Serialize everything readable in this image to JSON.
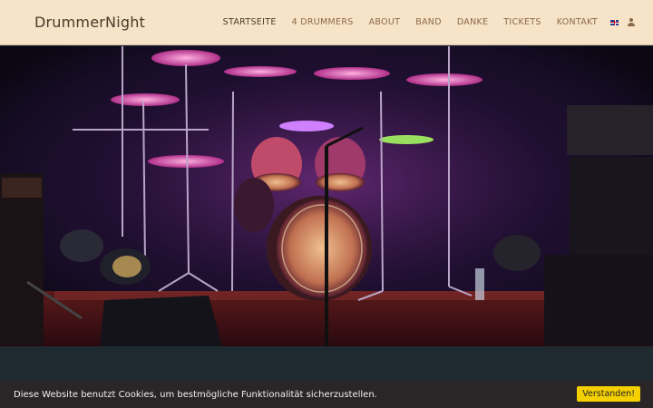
{
  "header": {
    "brand": "DrummerNight",
    "nav": [
      {
        "label": "STARTSEITE",
        "active": true
      },
      {
        "label": "4 DRUMMERS",
        "active": false
      },
      {
        "label": "ABOUT",
        "active": false
      },
      {
        "label": "BAND",
        "active": false
      },
      {
        "label": "DANKE",
        "active": false
      },
      {
        "label": "TICKETS",
        "active": false
      },
      {
        "label": "KONTAKT",
        "active": false
      }
    ],
    "language_icon": "uk-flag-icon",
    "user_icon": "user-icon"
  },
  "hero": {
    "image": "drum-kit-on-stage-photo"
  },
  "cookie": {
    "text": "Diese Website benutzt Cookies, um bestmögliche Funktionalität sicherzustellen.",
    "button": "Verstanden!"
  },
  "colors": {
    "header_bg": "#f7e3c8",
    "brand_text": "#4a3a28",
    "nav_text": "#8a6a46",
    "dark_band": "#1f2a30",
    "cookie_bg": "#2a2526",
    "cookie_button": "#f5d000"
  }
}
